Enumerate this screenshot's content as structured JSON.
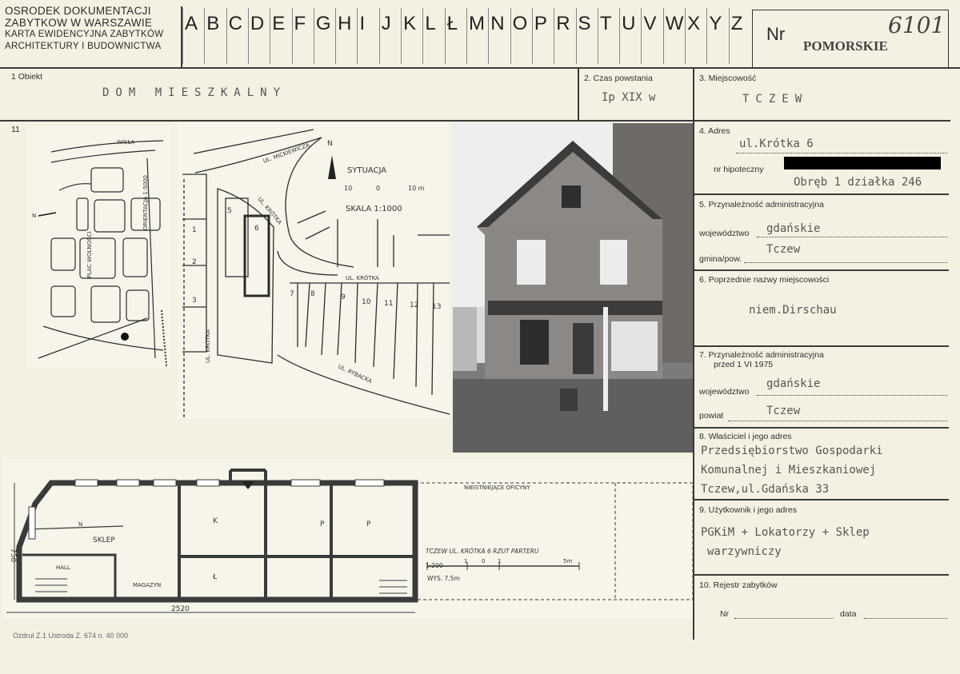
{
  "header": {
    "org_line1": "OSRODEK DOKUMENTACJI",
    "org_line2": "ZABYTKOW W WARSZAWIE",
    "card_line1": "KARTA EWIDENCYJNA ZABYTKÓW",
    "card_line2": "ARCHITEKTURY I BUDOWNICTWA",
    "letters": [
      "A",
      "B",
      "C",
      "D",
      "E",
      "F",
      "G",
      "H",
      "I",
      "J",
      "K",
      "L",
      "Ł",
      "M",
      "N",
      "O",
      "P",
      "R",
      "S",
      "T",
      "U",
      "V",
      "W",
      "X",
      "Y",
      "Z"
    ],
    "nr_label": "Nr",
    "nr_region": "POMORSKIE",
    "nr_handwritten": "6101"
  },
  "fields": {
    "f1_label": "1 Obiekt",
    "f1_value": "DOM MIESZKALNY",
    "f2_label": "2. Czas powstania",
    "f2_value": "Ip XIX w",
    "f3_label": "3. Miejscowość",
    "f3_value": "TCZEW",
    "f11_label": "11",
    "f4_label": "4. Adres",
    "f4_value": "ul.Krótka 6",
    "f4_hip_label": "nr hipoteczny",
    "f4_plot": "Obręb 1 działka 246",
    "f5_label": "5. Przynależność administracyjna",
    "f5_woj_label": "województwo",
    "f5_woj": "gdańskie",
    "f5_gmina_label": "gmina/pow.",
    "f5_gmina": "Tczew",
    "f6_label": "6. Poprzednie nazwy miejscowości",
    "f6_value": "niem.Dirschau",
    "f7_label": "7. Przynależność administracyjna",
    "f7_label2": "przed 1 VI 1975",
    "f7_woj_label": "województwo",
    "f7_woj": "gdańskie",
    "f7_pow_label": "powiat",
    "f7_pow": "Tczew",
    "f8_label": "8. Właściciel i jego adres",
    "f8_line1": "Przedsiębiorstwo Gospodarki",
    "f8_line2": "Komunalnej i Mieszkaniowej",
    "f8_line3": "Tczew,ul.Gdańska 33",
    "f9_label": "9. Użytkownik i jego adres",
    "f9_line1": "PGKiM + Lokatorzy + Sklep",
    "f9_line2": "warzywniczy",
    "f10_label": "10. Rejestr zabytków",
    "f10_nr": "Nr",
    "f10_data": "data"
  },
  "sitemap": {
    "title": "SYTUACJA",
    "scale": "SKALA 1:1000",
    "scale_ticks": [
      "10",
      "0",
      "10 m"
    ],
    "north": "N",
    "streets": [
      "UL. MICKIEWICZA",
      "UL. KRÓTKA",
      "UL. KRÓTKA",
      "UL. RYBACKA"
    ],
    "numbers": [
      "1",
      "2",
      "3",
      "5",
      "6",
      "7",
      "8",
      "9",
      "10",
      "11",
      "12",
      "13"
    ]
  },
  "citymap": {
    "labels": [
      "WISŁA",
      "ORIENTACJA 1:5000",
      "PLAC WOLNOŚCI",
      "N"
    ]
  },
  "floorplan": {
    "rooms": [
      "SKLEP",
      "HALL",
      "MAGAZYN",
      "K",
      "Ł",
      "P",
      "P"
    ],
    "dim_width": "2520",
    "dim_height": "750",
    "north": "N",
    "missing": "NIEISTNIEJĄCE OFICYNY",
    "caption": "TCZEW  UL. KRÓTKA 6   RZUT PARTERU",
    "scale": "1:200",
    "scale_ticks": [
      "1",
      "0",
      "1",
      "5m"
    ],
    "height_note": "WYS. 7,5m"
  },
  "footer": {
    "print_note": "Ozdruł Z.1  Ustroda Z. 674 n. 40 000"
  }
}
